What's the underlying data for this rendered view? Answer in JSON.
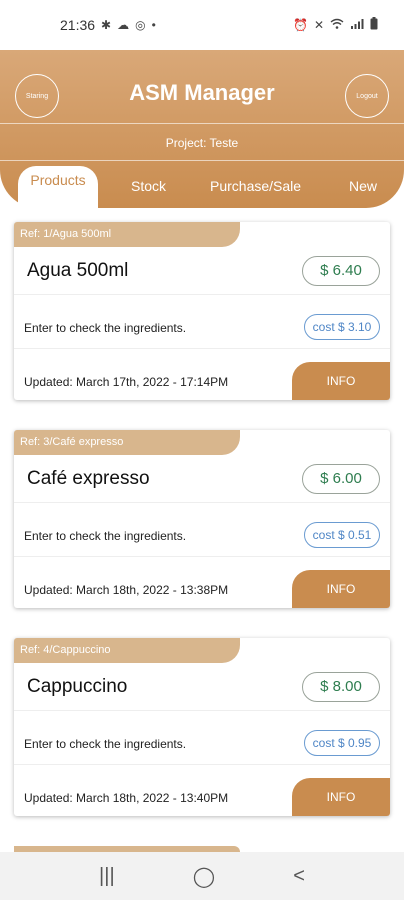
{
  "status_bar": {
    "time": "21:36",
    "left_icons": [
      "settings-icon",
      "cloud-icon",
      "instagram-icon",
      "dot-icon"
    ],
    "right_icons": [
      "alarm-icon",
      "mute-icon",
      "wifi-icon",
      "signal-icon",
      "battery-icon"
    ]
  },
  "header": {
    "title": "ASM Manager",
    "left_button": "Staring",
    "right_button": "Logout",
    "project": "Project: Teste",
    "tabs": [
      {
        "label": "Products",
        "active": true
      },
      {
        "label": "Stock",
        "active": false
      },
      {
        "label": "Purchase/Sale",
        "active": false
      },
      {
        "label": "New",
        "active": false
      }
    ]
  },
  "products": [
    {
      "ref": "Ref: 1/Agua 500ml",
      "name": "Agua 500ml",
      "price": "$ 6.40",
      "ingredients_hint": "Enter to check the ingredients.",
      "cost": "cost $ 3.10",
      "updated": "Updated: March 17th, 2022 - 17:14PM",
      "info_label": "INFO"
    },
    {
      "ref": "Ref: 3/Café expresso",
      "name": "Café expresso",
      "price": "$ 6.00",
      "ingredients_hint": "Enter to check the ingredients.",
      "cost": "cost $ 0.51",
      "updated": "Updated: March 18th, 2022 - 13:38PM",
      "info_label": "INFO"
    },
    {
      "ref": "Ref: 4/Cappuccino",
      "name": "Cappuccino",
      "price": "$ 8.00",
      "ingredients_hint": "Enter to check the ingredients.",
      "cost": "cost $ 0.95",
      "updated": "Updated: March 18th, 2022 - 13:40PM",
      "info_label": "INFO"
    }
  ],
  "nav_bar": {
    "recents_icon": "|||",
    "home_icon": "◯",
    "back_icon": "<"
  },
  "colors": {
    "header_gradient_top": "#d9a878",
    "header_gradient_bottom": "#c98c4f",
    "ref_tag": "#d8b68d",
    "price_text": "#2e7d4f",
    "cost_text": "#4f86c6",
    "info_button": "#c98c4f"
  }
}
